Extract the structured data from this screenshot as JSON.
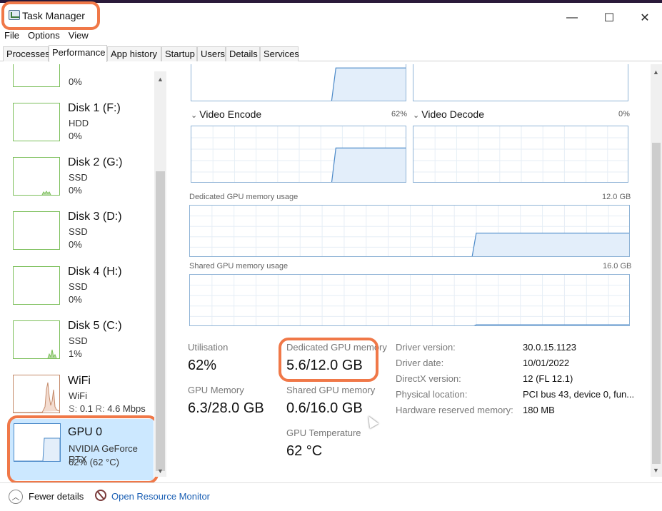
{
  "window": {
    "title": "Task Manager",
    "minimize_glyph": "—",
    "maximize_glyph": "☐",
    "close_glyph": "✕"
  },
  "menu": [
    "File",
    "Options",
    "View"
  ],
  "tabs": [
    "Processes",
    "Performance",
    "App history",
    "Startup",
    "Users",
    "Details",
    "Services"
  ],
  "active_tab": "Performance",
  "sidebar": {
    "top_partial": {
      "value": "0%"
    },
    "items": [
      {
        "name": "Disk 1 (F:)",
        "type": "HDD",
        "value": "0%"
      },
      {
        "name": "Disk 2 (G:)",
        "type": "SSD",
        "value": "0%"
      },
      {
        "name": "Disk 3 (D:)",
        "type": "SSD",
        "value": "0%"
      },
      {
        "name": "Disk 4 (H:)",
        "type": "SSD",
        "value": "0%"
      },
      {
        "name": "Disk 5 (C:)",
        "type": "SSD",
        "value": "1%"
      }
    ],
    "wifi": {
      "name": "WiFi",
      "type": "WiFi",
      "s_label": "S:",
      "s_value": "0.1",
      "r_label": "R:",
      "r_value": "4.6 Mbps"
    },
    "gpu": {
      "name": "GPU 0",
      "model": "NVIDIA GeForce RTX",
      "value": "62%  (62 °C)"
    }
  },
  "engines": {
    "video_encode": {
      "label": "Video Encode",
      "percent": "62%",
      "level": 0.62
    },
    "video_decode": {
      "label": "Video Decode",
      "percent": "0%",
      "level": 0.0
    }
  },
  "memory_graphs": {
    "dedicated": {
      "label": "Dedicated GPU memory usage",
      "max": "12.0 GB",
      "level": 0.47
    },
    "shared": {
      "label": "Shared GPU memory usage",
      "max": "16.0 GB",
      "level": 0.04
    }
  },
  "stats": {
    "utilisation": {
      "label": "Utilisation",
      "value": "62%"
    },
    "dedicated_memory": {
      "label": "Dedicated GPU memory",
      "value": "5.6/12.0 GB"
    },
    "gpu_memory": {
      "label": "GPU Memory",
      "value": "6.3/28.0 GB"
    },
    "shared_memory": {
      "label": "Shared GPU memory",
      "value": "0.6/16.0 GB"
    },
    "gpu_temperature": {
      "label": "GPU Temperature",
      "value": "62 °C"
    }
  },
  "info": [
    {
      "label": "Driver version:",
      "value": "30.0.15.1123"
    },
    {
      "label": "Driver date:",
      "value": "10/01/2022"
    },
    {
      "label": "DirectX version:",
      "value": "12 (FL 12.1)"
    },
    {
      "label": "Physical location:",
      "value": "PCI bus 43, device 0, fun..."
    },
    {
      "label": "Hardware reserved memory:",
      "value": "180 MB"
    }
  ],
  "footer": {
    "fewer_details": "Fewer details",
    "open_resource_monitor": "Open Resource Monitor"
  },
  "colors": {
    "highlight": "#f07848",
    "graph_line": "#4b89c8",
    "graph_fill": "#e3eefa",
    "disk_border": "#7cbf5b",
    "selected": "#cce8ff"
  }
}
